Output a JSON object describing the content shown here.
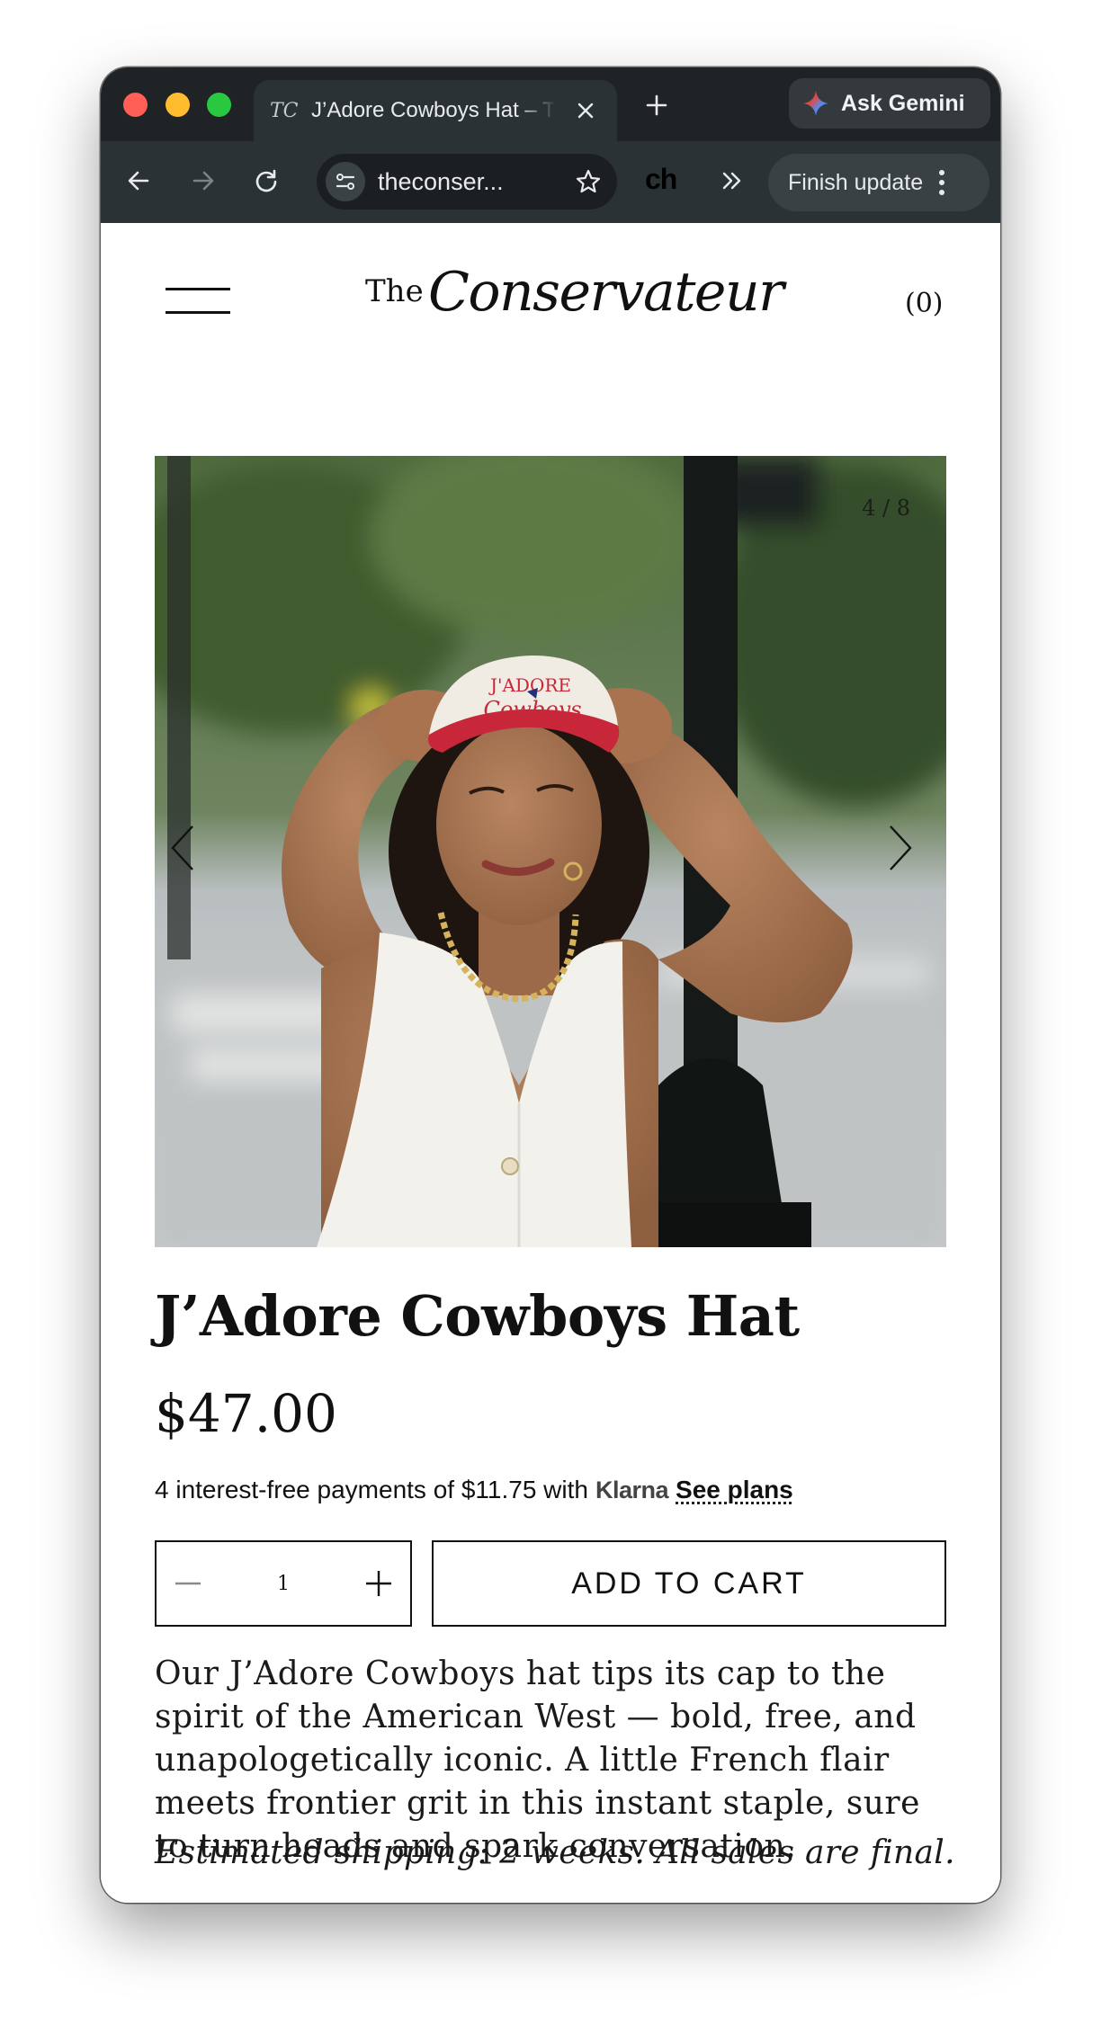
{
  "browser": {
    "tab": {
      "favicon_text": "TC",
      "title": "J’Adore Cowboys Hat – The Conservateur"
    },
    "gemini_label": "Ask Gemini",
    "url": "theconser...",
    "extension_label": "ch",
    "finish_update_label": "Finish update",
    "icons": [
      "back-icon",
      "forward-icon",
      "reload-icon",
      "site-info-icon",
      "bookmark-star-icon",
      "chevron-double-right-icon",
      "kebab-menu-icon",
      "close-icon",
      "plus-icon",
      "gemini-sparkle-icon"
    ]
  },
  "site": {
    "logo_the": "The",
    "logo_word": "Conservateur",
    "cart_count": "(0)"
  },
  "gallery": {
    "counter": "4 / 8",
    "current": 4,
    "total": 8,
    "hat_text_top": "J'ADORE",
    "hat_text_bottom": "Cowboys"
  },
  "product": {
    "title": "J’Adore Cowboys Hat",
    "price": "$47.00",
    "klarna_text": "4 interest-free payments of $11.75 with",
    "klarna_brand": "Klarna",
    "see_plans": "See plans",
    "quantity": "1",
    "add_to_cart": "ADD TO CART",
    "description": "Our J’Adore Cowboys hat tips its cap to the spirit of the American West — bold, free, and unapologetically iconic. A little French flair meets frontier grit in this instant staple, sure to turn heads and spark conversation.",
    "shipping": "Estimated shipping: 2 weeks. All sales are final."
  },
  "colors": {
    "chrome_dark": "#1f2326",
    "chrome_toolbar": "#2b3236",
    "hat_red": "#c8273a",
    "text": "#111111"
  }
}
